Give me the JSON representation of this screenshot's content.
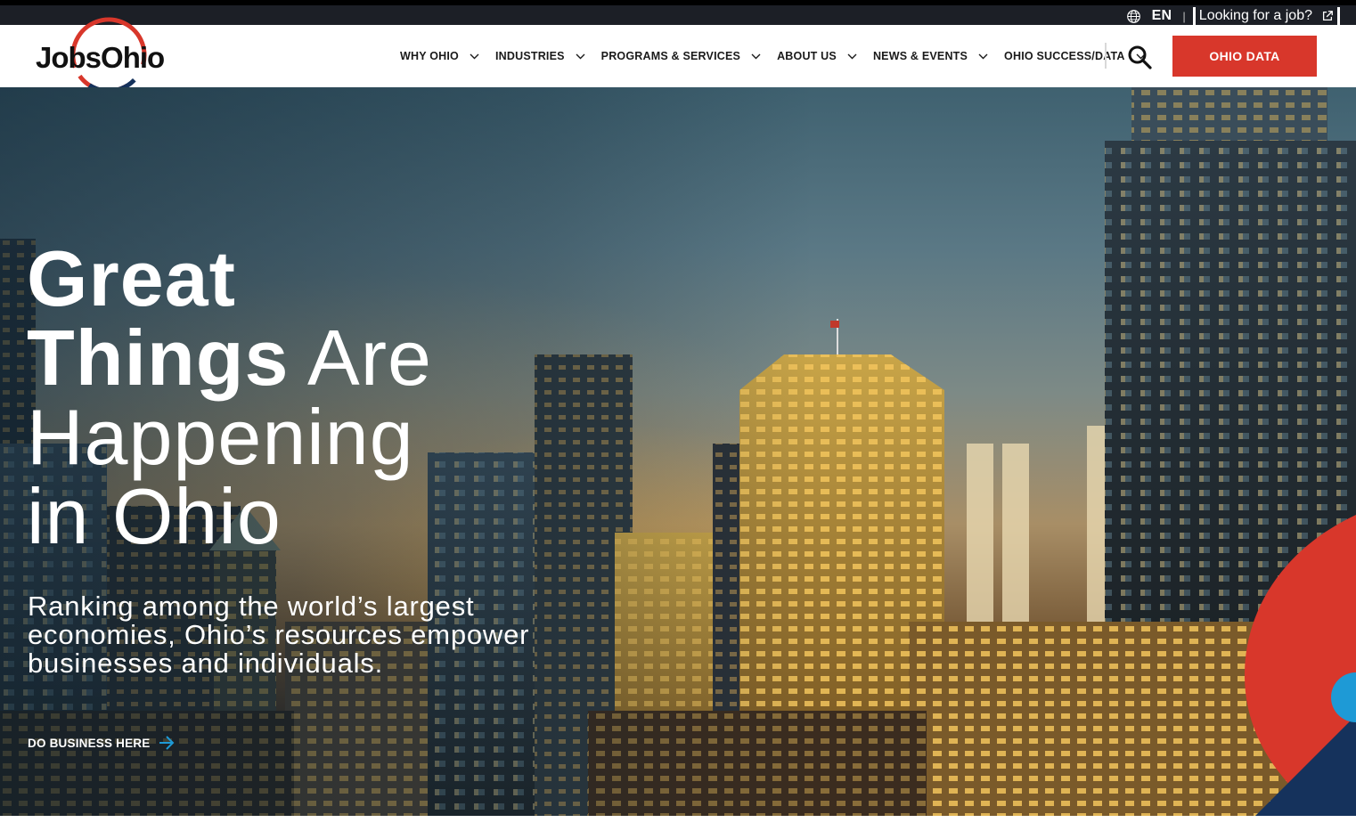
{
  "utility": {
    "language": "EN",
    "separator": "|",
    "job_link": "Looking for a job?"
  },
  "header": {
    "logo_text": "JobsOhio",
    "nav": [
      {
        "label": "WHY OHIO"
      },
      {
        "label": "INDUSTRIES"
      },
      {
        "label": "PROGRAMS & SERVICES"
      },
      {
        "label": "ABOUT US"
      },
      {
        "label": "NEWS & EVENTS"
      },
      {
        "label": "OHIO SUCCESS/DATA"
      }
    ],
    "cta_label": "OHIO DATA"
  },
  "hero": {
    "title_bold_1": "Great",
    "title_bold_2": "Things",
    "title_light_1": "Are",
    "title_light_2": "Happening",
    "title_light_3": "in Ohio",
    "subtitle": "Ranking among the world’s largest economies, Ohio’s resources empower businesses and individuals.",
    "link_label": "DO BUSINESS HERE"
  },
  "colors": {
    "brand_red": "#d8372b",
    "brand_navy": "#15325c",
    "brand_blue": "#1e9ad6",
    "utility_bar": "#1c1f26"
  },
  "icons": [
    "globe-icon",
    "external-link-icon",
    "chevron-down-icon",
    "search-icon",
    "arrow-right-icon"
  ]
}
